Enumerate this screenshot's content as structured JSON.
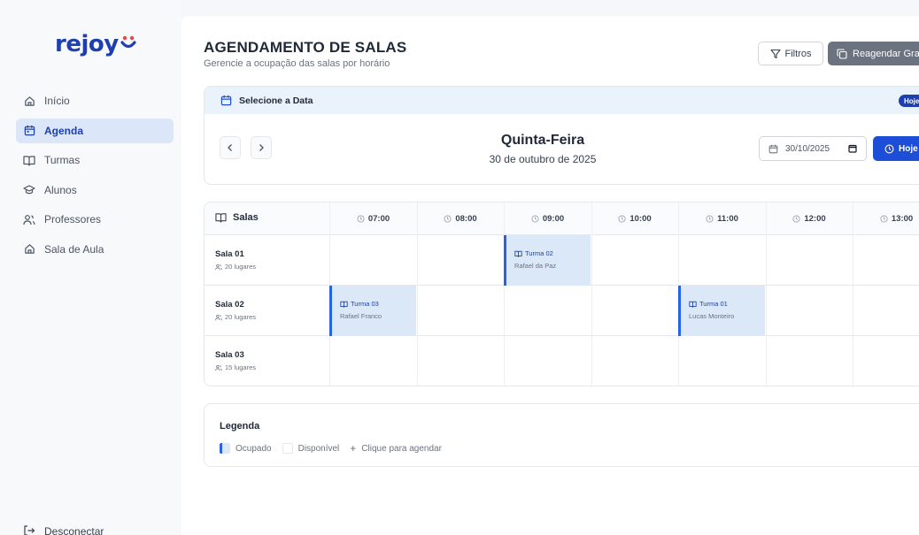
{
  "sidebar": {
    "logo": "rejoy",
    "items": [
      {
        "label": "Início",
        "icon": "home-icon"
      },
      {
        "label": "Agenda",
        "icon": "calendar-icon",
        "active": true
      },
      {
        "label": "Turmas",
        "icon": "book-icon"
      },
      {
        "label": "Alunos",
        "icon": "graduation-cap-icon"
      },
      {
        "label": "Professores",
        "icon": "users-icon"
      },
      {
        "label": "Sala de Aula",
        "icon": "home-icon"
      }
    ],
    "logout": "Desconectar"
  },
  "header": {
    "title": "AGENDAMENTO DE SALAS",
    "subtitle": "Gerencie a ocupação das salas por horário",
    "filters_label": "Filtros",
    "reschedule_label": "Reagendar Gra"
  },
  "date_selector": {
    "heading": "Selecione a Data",
    "badge": "Hoje",
    "day_name": "Quinta-Feira",
    "full_date": "30 de outubro de 2025",
    "date_value": "30/10/2025",
    "today_button": "Hoje"
  },
  "schedule": {
    "rooms_header": "Salas",
    "times": [
      "07:00",
      "08:00",
      "09:00",
      "10:00",
      "11:00",
      "12:00",
      "13:00"
    ],
    "rooms": [
      {
        "name": "Sala 01",
        "capacity": "20 lugares",
        "bookings": [
          {
            "slot": 2,
            "class": "Turma 02",
            "teacher": "Rafael da Paz"
          }
        ]
      },
      {
        "name": "Sala 02",
        "capacity": "20 lugares",
        "bookings": [
          {
            "slot": 0,
            "class": "Turma 03",
            "teacher": "Rafael Franco"
          },
          {
            "slot": 4,
            "class": "Turma 01",
            "teacher": "Lucas Monteiro"
          }
        ]
      },
      {
        "name": "Sala 03",
        "capacity": "15 lugares",
        "bookings": []
      }
    ]
  },
  "legend": {
    "title": "Legenda",
    "occupied": "Ocupado",
    "available": "Disponível",
    "click_to_schedule": "Clique para agendar"
  },
  "colors": {
    "accent": "#1d4ed8",
    "booked_bg": "#dbe8f7",
    "booked_border": "#2563eb",
    "active_nav_bg": "#dbe6f8"
  }
}
